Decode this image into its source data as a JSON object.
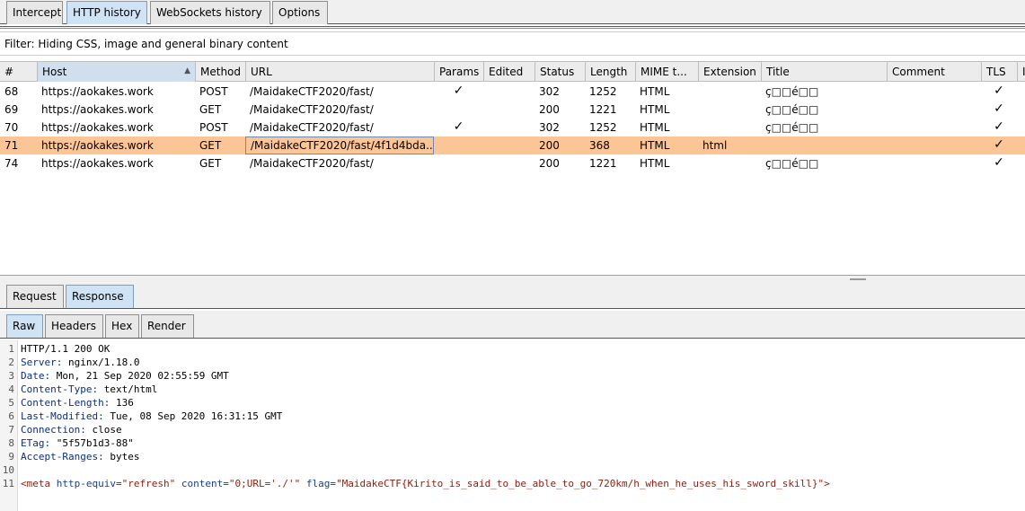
{
  "top_tabs": [
    "Intercept",
    "HTTP history",
    "WebSockets history",
    "Options"
  ],
  "filter_text": "Filter: Hiding CSS, image and general binary content",
  "columns": [
    "#",
    "Host",
    "Method",
    "URL",
    "Params",
    "Edited",
    "Status",
    "Length",
    "MIME t...",
    "Extension",
    "Title",
    "Comment",
    "TLS",
    "I"
  ],
  "sorted_column": "Host",
  "rows": [
    {
      "num": "68",
      "host": "https://aokakes.work",
      "method": "POST",
      "url": "/MaidakeCTF2020/fast/",
      "params": "✓",
      "status": "302",
      "length": "1252",
      "mime": "HTML",
      "extension": "",
      "title": "ç□□é□□",
      "tls": "✓"
    },
    {
      "num": "69",
      "host": "https://aokakes.work",
      "method": "GET",
      "url": "/MaidakeCTF2020/fast/",
      "params": "",
      "status": "200",
      "length": "1221",
      "mime": "HTML",
      "extension": "",
      "title": "ç□□é□□",
      "tls": "✓"
    },
    {
      "num": "70",
      "host": "https://aokakes.work",
      "method": "POST",
      "url": "/MaidakeCTF2020/fast/",
      "params": "✓",
      "status": "302",
      "length": "1252",
      "mime": "HTML",
      "extension": "",
      "title": "ç□□é□□",
      "tls": "✓"
    },
    {
      "num": "71",
      "host": "https://aokakes.work",
      "method": "GET",
      "url": "/MaidakeCTF2020/fast/4f1d4bda...",
      "params": "",
      "status": "200",
      "length": "368",
      "mime": "HTML",
      "extension": "html",
      "title": "",
      "tls": "✓"
    },
    {
      "num": "74",
      "host": "https://aokakes.work",
      "method": "GET",
      "url": "/MaidakeCTF2020/fast/",
      "params": "",
      "status": "200",
      "length": "1221",
      "mime": "HTML",
      "extension": "",
      "title": "ç□□é□□",
      "tls": "✓"
    }
  ],
  "selected_row": "71",
  "req_tabs": [
    "Request",
    "Response"
  ],
  "active_req_tab": "Response",
  "view_tabs": [
    "Raw",
    "Headers",
    "Hex",
    "Render"
  ],
  "active_view_tab": "Raw",
  "response_lines": [
    {
      "n": "1",
      "name": "",
      "value": "HTTP/1.1 200 OK"
    },
    {
      "n": "2",
      "name": "Server:",
      "value": " nginx/1.18.0"
    },
    {
      "n": "3",
      "name": "Date:",
      "value": " Mon, 21 Sep 2020 02:55:59 GMT"
    },
    {
      "n": "4",
      "name": "Content-Type:",
      "value": " text/html"
    },
    {
      "n": "5",
      "name": "Content-Length:",
      "value": " 136"
    },
    {
      "n": "6",
      "name": "Last-Modified:",
      "value": " Tue, 08 Sep 2020 16:31:15 GMT"
    },
    {
      "n": "7",
      "name": "Connection:",
      "value": " close"
    },
    {
      "n": "8",
      "name": "ETag:",
      "value": " \"5f57b1d3-88\""
    },
    {
      "n": "9",
      "name": "Accept-Ranges:",
      "value": " bytes"
    },
    {
      "n": "10",
      "name": "",
      "value": ""
    }
  ],
  "html_line": {
    "n": "11",
    "open": "<meta",
    "a1": " http-equiv=",
    "v1": "\"refresh\"",
    "a2": " content=",
    "v2": "\"0;URL='./'\"",
    "a3": " flag=",
    "v3": "\"MaidakeCTF{Kirito_is_said_to_be_able_to_go_720km/h_when_he_uses_his_sword_skill}\"",
    "close": ">"
  }
}
